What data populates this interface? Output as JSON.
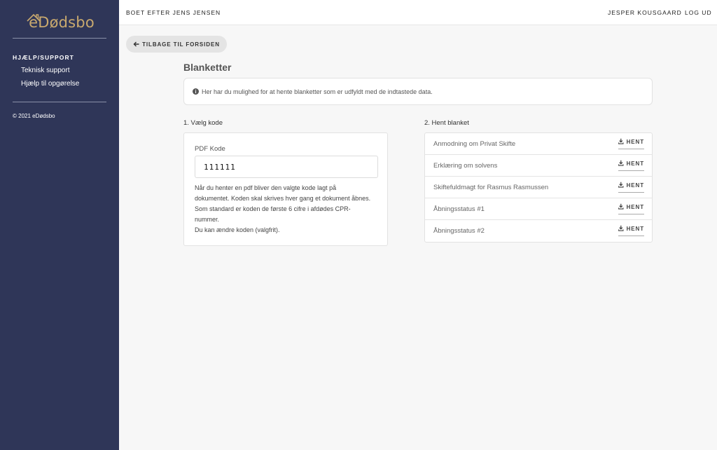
{
  "sidebar": {
    "logo_text": "eDødsbo",
    "heading": "HJÆLP/SUPPORT",
    "links": [
      "Teknisk support",
      "Hjælp til opgørelse"
    ],
    "copyright": "© 2021 eDødsbo",
    "colors": {
      "background": "#2f3658",
      "logo": "#c9a96e"
    }
  },
  "topbar": {
    "title": "BOET EFTER JENS JENSEN",
    "user": "JESPER KOUSGAARD",
    "logout": "LOG UD"
  },
  "back_button": {
    "label": "TILBAGE TIL FORSIDEN",
    "icon": "arrow-left-icon"
  },
  "page": {
    "title": "Blanketter",
    "info_text": "Her har du mulighed for at hente blanketter som er udfyldt med de indtastede data.",
    "info_icon": "info-circle-icon"
  },
  "code_section": {
    "label": "1. Vælg kode",
    "field_label": "PDF Kode",
    "field_value": "111111",
    "help_lines": [
      "Når du henter en pdf bliver den valgte kode lagt på",
      "dokumentet. Koden skal skrives hver gang et dokument åbnes.",
      "Som standard er koden de første 6 cifre i afdødes CPR-",
      "nummer.",
      "Du kan ændre koden (valgfrit)."
    ]
  },
  "blank_section": {
    "label": "2. Hent blanket",
    "button_label": "HENT",
    "button_icon": "download-icon",
    "items": [
      "Anmodning om Privat Skifte",
      "Erklæring om solvens",
      "Skiftefuldmagt for Rasmus Rasmussen",
      "Åbningsstatus #1",
      "Åbningsstatus #2"
    ]
  }
}
